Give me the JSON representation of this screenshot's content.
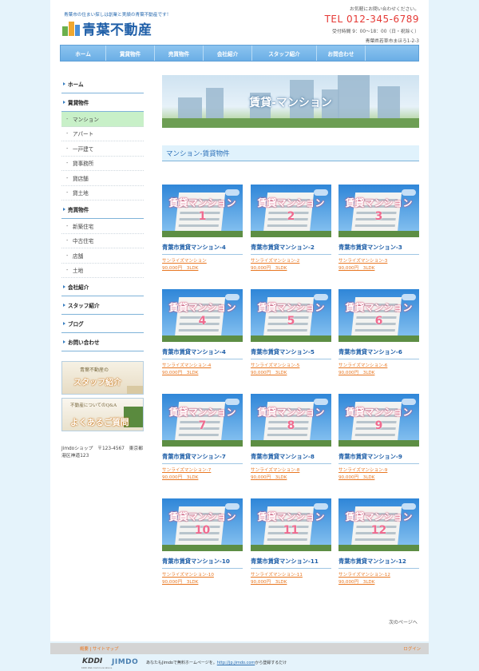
{
  "header": {
    "tagline": "青葉市の住まい探しは創業と実績の青葉不動産です！",
    "logo_text": "青葉不動産",
    "inquiry": "お気軽にお問い合わせください。",
    "tel": "TEL 012-345-6789",
    "hours": "受付時間 9：00～18：00（日・祝除く）",
    "address": "青葉県若草市まほろ1-2-3"
  },
  "nav": {
    "items": [
      {
        "label": "ホーム"
      },
      {
        "label": "賃貸物件"
      },
      {
        "label": "売買物件"
      },
      {
        "label": "会社紹介"
      },
      {
        "label": "スタッフ紹介"
      },
      {
        "label": "お問合わせ"
      }
    ]
  },
  "sidebar": {
    "home": "ホーム",
    "rental": "賃貸物件",
    "rental_items": [
      "マンション",
      "アパート",
      "一戸建て",
      "貸事務所",
      "貸店舗",
      "貸土地"
    ],
    "sale": "売買物件",
    "sale_items": [
      "新築住宅",
      "中古住宅",
      "店舗",
      "土地"
    ],
    "company": "会社紹介",
    "staff": "スタッフ紹介",
    "blog": "ブログ",
    "contact": "お問い合わせ",
    "banner1_small": "青葉不動産の",
    "banner1_big": "スタッフ紹介",
    "banner2_small": "不動産についてのQ&A",
    "banner2_big": "よくあるご質問",
    "shop_address": "Jimdoショップ　〒123-4567　東京都港区神道123"
  },
  "main": {
    "hero_title": "賃貸-マンション",
    "section_title": "マンション-賃貸物件",
    "thumb_label": "賃貸マンション",
    "cards": [
      {
        "num": "1",
        "name": "青葉市賃貸マンション-4",
        "link1": "サンライズマンション",
        "link2": "90,000円　3LDK"
      },
      {
        "num": "2",
        "name": "青葉市賃貸マンション-2",
        "link1": "サンライズマンション-2",
        "link2": "90,000円　3LDK"
      },
      {
        "num": "3",
        "name": "青葉市賃貸マンション-3",
        "link1": "サンライズマンション-3",
        "link2": "90,000円　3LDK"
      },
      {
        "num": "4",
        "name": "青葉市賃貸マンション-4",
        "link1": "サンライズマンション-4",
        "link2": "90,000円　3LDK"
      },
      {
        "num": "5",
        "name": "青葉市賃貸マンション-5",
        "link1": "サンライズマンション-5",
        "link2": "90,000円　3LDK"
      },
      {
        "num": "6",
        "name": "青葉市賃貸マンション-6",
        "link1": "サンライズマンション-6",
        "link2": "90,000円　3LDK"
      },
      {
        "num": "7",
        "name": "青葉市賃貸マンション-7",
        "link1": "サンライズマンション-7",
        "link2": "90,000円　3LDK"
      },
      {
        "num": "8",
        "name": "青葉市賃貸マンション-8",
        "link1": "サンライズマンション-8",
        "link2": "90,000円　3LDK"
      },
      {
        "num": "9",
        "name": "青葉市賃貸マンション-9",
        "link1": "サンライズマンション-9",
        "link2": "90,000円　3LDK"
      },
      {
        "num": "10",
        "name": "青葉市賃貸マンション-10",
        "link1": "サンライズマンション-10",
        "link2": "90,000円　3LDK"
      },
      {
        "num": "11",
        "name": "青葉市賃貸マンション-11",
        "link1": "サンライズマンション-11",
        "link2": "90,000円　3LDK"
      },
      {
        "num": "12",
        "name": "青葉市賃貸マンション-12",
        "link1": "サンライズマンション-12",
        "link2": "90,000円　3LDK"
      }
    ],
    "next_page": "次のページへ"
  },
  "footer": {
    "links": "概要 | サイトマップ",
    "login": "ログイン",
    "kddi": "KDDI",
    "kddi_sub": "KDDI Web Communications",
    "jimdo": "JIMDO",
    "promo_before": "あなたもJimdoで無料ホームページを。",
    "promo_link": "http://jp.jimdo.com",
    "promo_after": "から登録するだけ"
  },
  "colors": {
    "background": "#e5f3fb",
    "nav": "#6aaee6",
    "link": "#e87722",
    "title": "#1f5fa8",
    "tel": "#e53935"
  }
}
